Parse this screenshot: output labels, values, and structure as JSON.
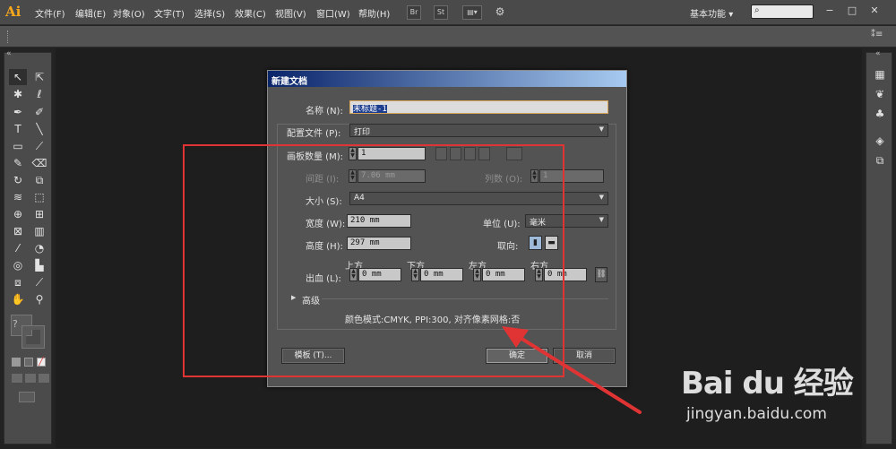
{
  "app": {
    "logo": "Ai",
    "menu": [
      "文件(F)",
      "编辑(E)",
      "对象(O)",
      "文字(T)",
      "选择(S)",
      "效果(C)",
      "视图(V)",
      "窗口(W)",
      "帮助(H)"
    ],
    "toolbar_icons": [
      "Br",
      "St",
      "arrange-documents-icon",
      "gpu-performance-icon"
    ],
    "workspace": "基本功能",
    "workspace_arrow": "▾",
    "search_placeholder": "",
    "window_controls": [
      "−",
      "□",
      "✕"
    ],
    "panel_collapse": "«"
  },
  "dialog": {
    "title": "新建文档",
    "name_label": "名称 (N):",
    "name_value": "未标题-1",
    "profile_label": "配置文件 (P):",
    "profile_value": "打印",
    "artboards_label": "画板数量 (M):",
    "artboards_value": "1",
    "spacing_label": "间距 (I):",
    "spacing_value": "7.06 mm",
    "columns_label": "列数 (O):",
    "columns_value": "1",
    "size_label": "大小 (S):",
    "size_value": "A4",
    "width_label": "宽度 (W):",
    "width_value": "210 mm",
    "units_label": "单位 (U):",
    "units_value": "毫米",
    "height_label": "高度 (H):",
    "height_value": "297 mm",
    "orientation_label": "取向:",
    "bleed_label": "出血 (L):",
    "bleed_top_label": "上方",
    "bleed_bottom_label": "下方",
    "bleed_left_label": "左方",
    "bleed_right_label": "右方",
    "bleed_top": "0 mm",
    "bleed_bottom": "0 mm",
    "bleed_left": "0 mm",
    "bleed_right": "0 mm",
    "advanced_label": "高级",
    "summary": "颜色模式:CMYK, PPI:300, 对齐像素网格:否",
    "templates_button": "模板 (T)...",
    "ok_button": "确定",
    "cancel_button": "取消"
  },
  "watermark": {
    "brand": "Bai du 经验",
    "url": "jingyan.baidu.com"
  },
  "colors": {
    "annotation_red": "#e03434",
    "title_gradient_start": "#0a246a",
    "title_gradient_end": "#a6caf0"
  }
}
